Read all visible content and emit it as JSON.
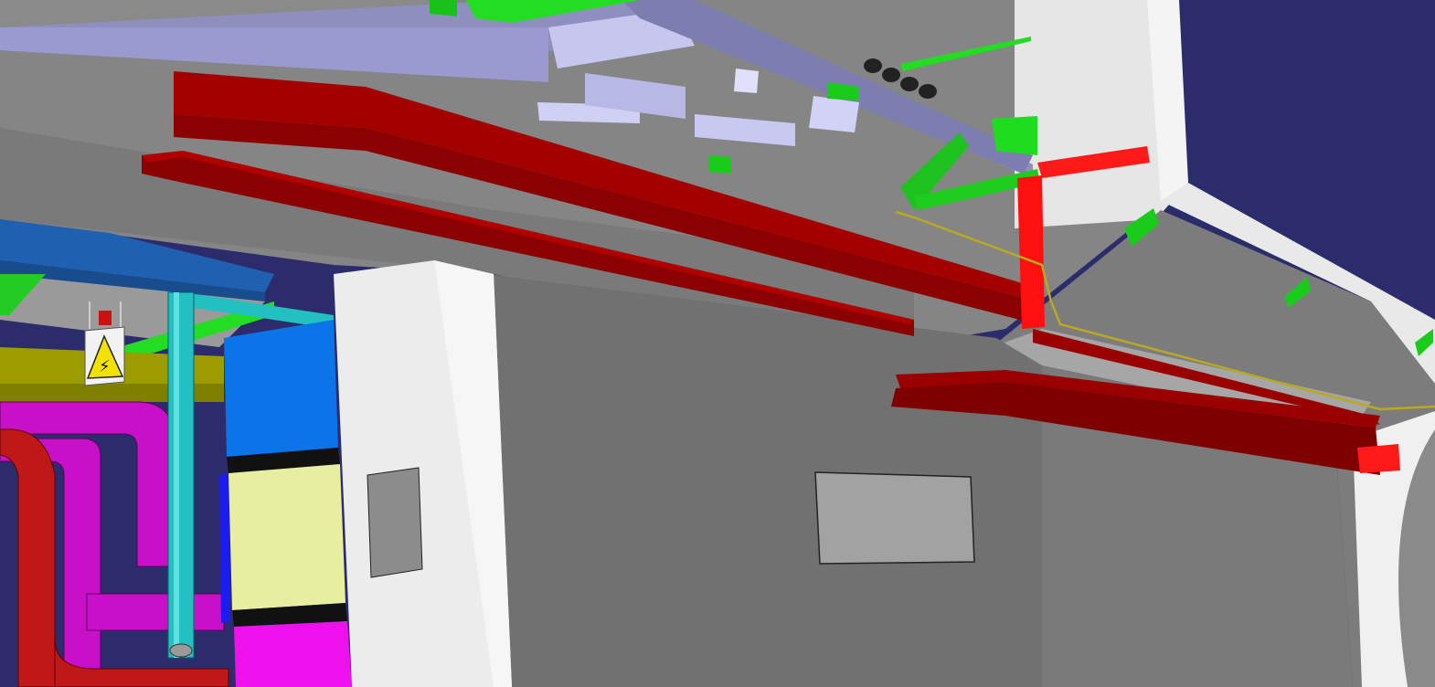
{
  "viewport": {
    "type": "3d-cad-model-view",
    "colors": {
      "sky": "#2c2c6c",
      "wall_grey": "#7f7f7f",
      "wall_dark": "#717171",
      "wall_white": "#e8e8e8",
      "steel_lavender": "#9a9ac8",
      "tray_red_dark": "#8b0000",
      "tray_red": "#a40000",
      "bracket_red": "#ff1a1a",
      "support_green": "#19d619",
      "duct_magenta": "#cc11cc",
      "pipe_red": "#c01818",
      "pipe_cyan": "#22c0c0",
      "duct_blue": "#2060b0",
      "panel_blue": "#0a74e8",
      "panel_cream": "#e8eea0",
      "panel_magenta": "#ee11ee",
      "warning_yellow": "#f2e200",
      "cable_yellow": "#b8aa20"
    }
  },
  "warning_sign": {
    "icon": "electrical-hazard-icon",
    "glyph": "⚡"
  }
}
